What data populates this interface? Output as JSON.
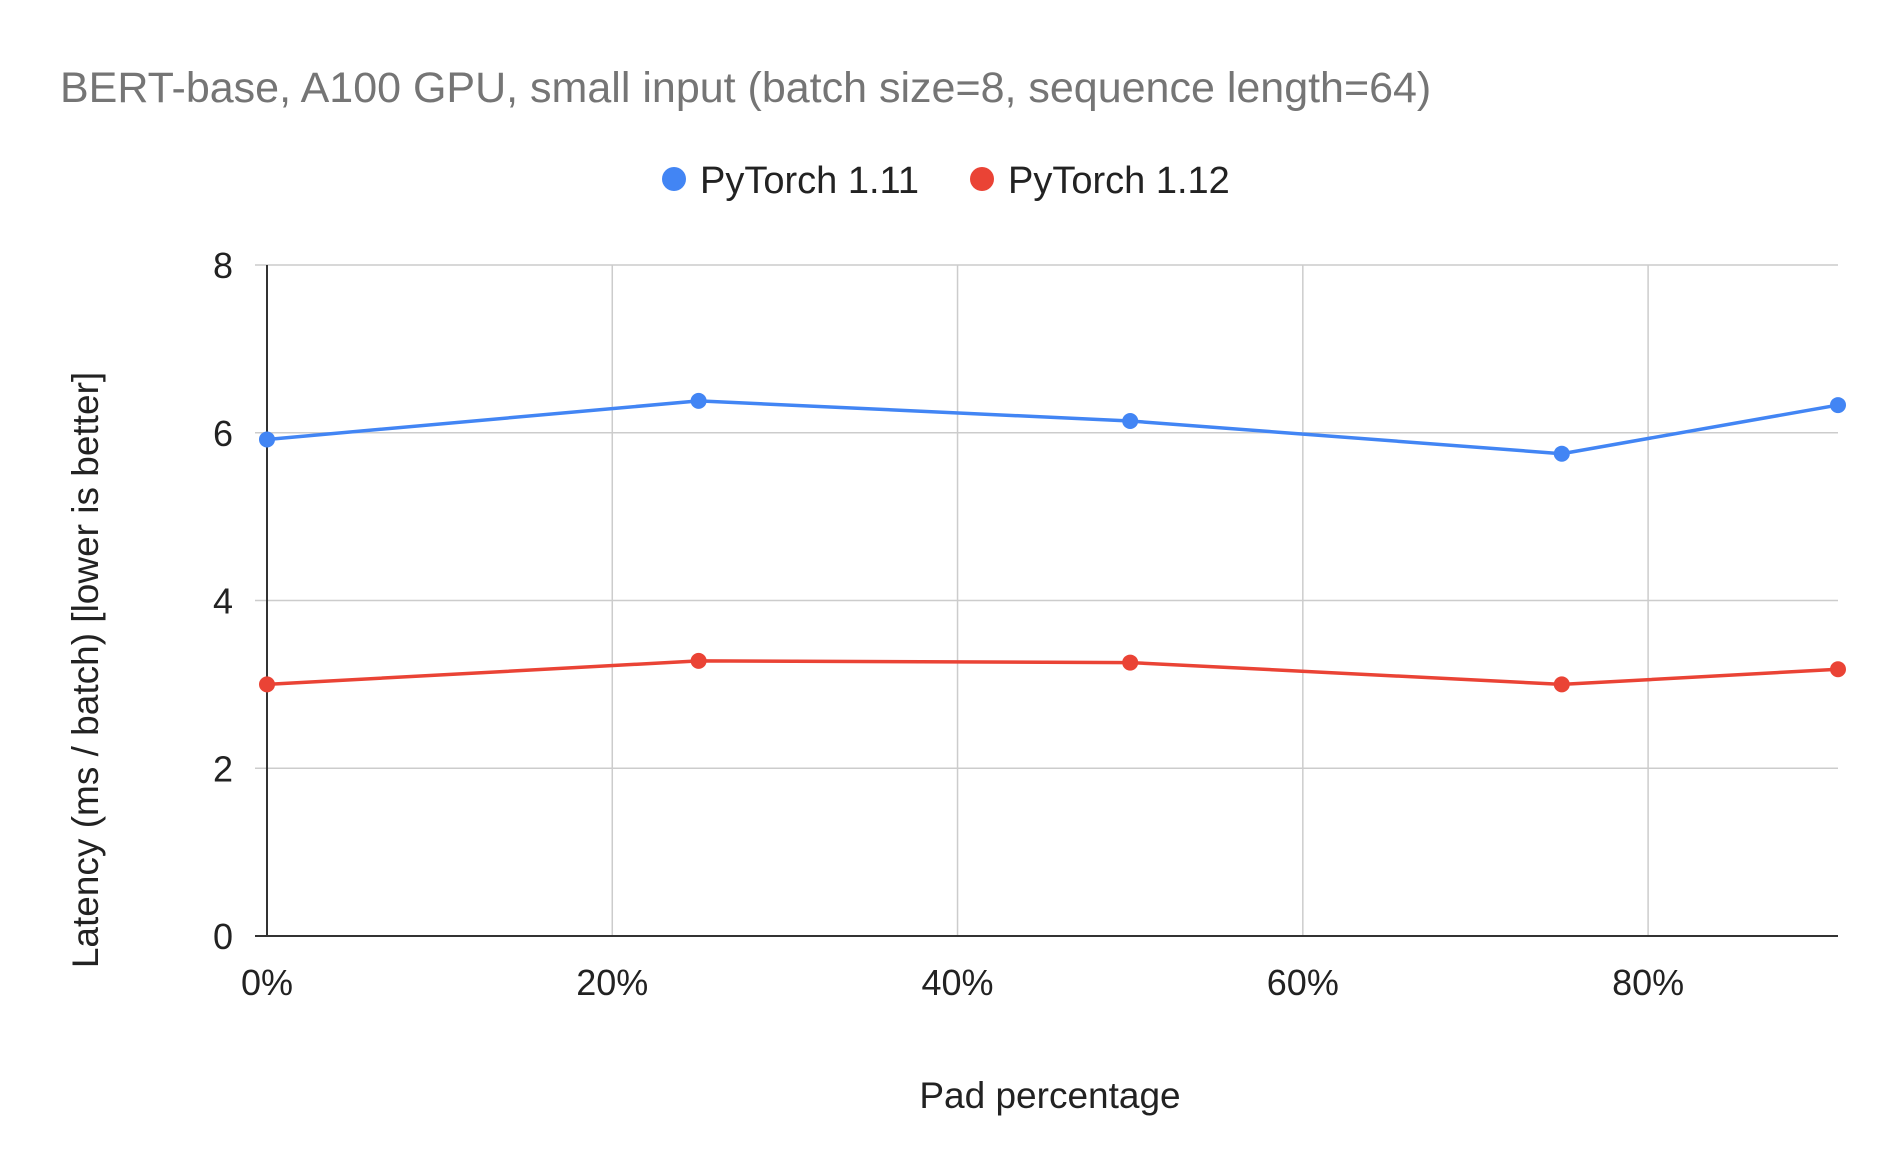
{
  "chart_data": {
    "type": "line",
    "title": "BERT-base, A100 GPU, small input (batch size=8, sequence length=64)",
    "xlabel": "Pad percentage",
    "ylabel": "Latency (ms / batch) [lower is better]",
    "x": [
      0,
      25,
      50,
      75,
      91
    ],
    "xlim": [
      0,
      91
    ],
    "ylim": [
      0,
      8
    ],
    "xticks": [
      0,
      20,
      40,
      60,
      80
    ],
    "xtick_labels": [
      "0%",
      "20%",
      "40%",
      "60%",
      "80%"
    ],
    "yticks": [
      0,
      2,
      4,
      6,
      8
    ],
    "ytick_labels": [
      "0",
      "2",
      "4",
      "6",
      "8"
    ],
    "grid": true,
    "legend_position": "top-center",
    "series": [
      {
        "name": "PyTorch 1.11",
        "color": "#4285f4",
        "values": [
          5.92,
          6.38,
          6.14,
          5.75,
          6.33
        ]
      },
      {
        "name": "PyTorch 1.12",
        "color": "#ea4335",
        "values": [
          3.0,
          3.28,
          3.26,
          3.0,
          3.18
        ]
      }
    ]
  }
}
